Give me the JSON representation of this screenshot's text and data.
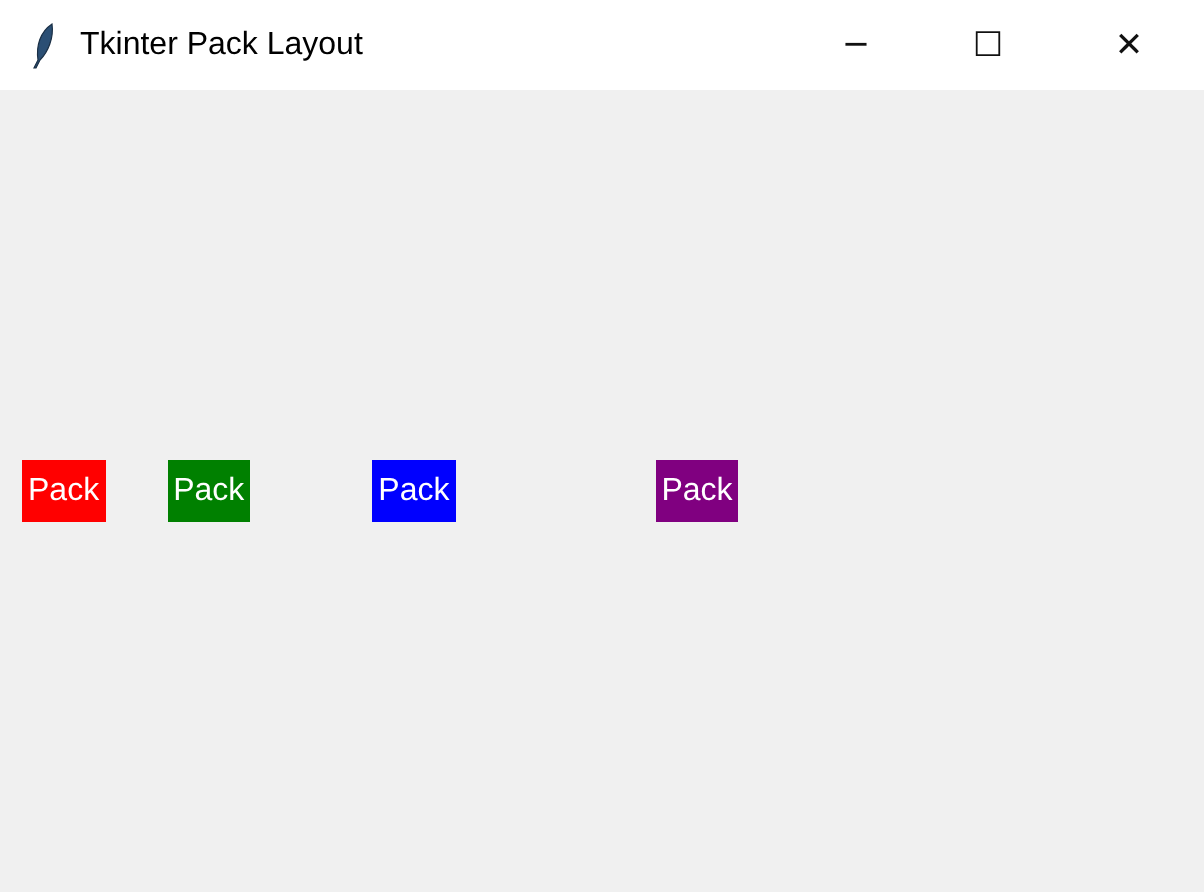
{
  "window": {
    "title": "Tkinter Pack Layout",
    "controls": [
      "─",
      "☐",
      "✕"
    ]
  },
  "labels": [
    {
      "text": "Pack",
      "color": "#ff0000"
    },
    {
      "text": "Pack",
      "color": "#008000"
    },
    {
      "text": "Pack",
      "color": "#0000ff"
    },
    {
      "text": "Pack",
      "color": "#800080"
    }
  ]
}
